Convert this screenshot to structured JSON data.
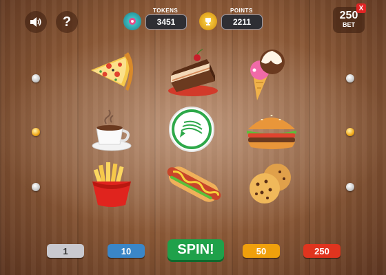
{
  "header": {
    "tokens_label": "TOKENS",
    "tokens_value": "3451",
    "points_label": "POINTS",
    "points_value": "2211",
    "help_label": "?",
    "bet_value": "250",
    "bet_label": "BET",
    "close_label": "X"
  },
  "reels": {
    "rows": [
      [
        "pizza-slice",
        "chocolate-cake",
        "ice-cream-cone"
      ],
      [
        "coffee-cup",
        "wild-green-token",
        "hamburger"
      ],
      [
        "french-fries",
        "hot-dog",
        "cookies"
      ]
    ]
  },
  "controls": {
    "bet_options": [
      "1",
      "10",
      "50",
      "250"
    ],
    "spin_label": "SPIN!"
  },
  "colors": {
    "bet_1": "#c9c9cf",
    "bet_10": "#3a86c8",
    "bet_50": "#f0a00c",
    "bet_250": "#e0341e",
    "spin": "#1fa14a"
  }
}
